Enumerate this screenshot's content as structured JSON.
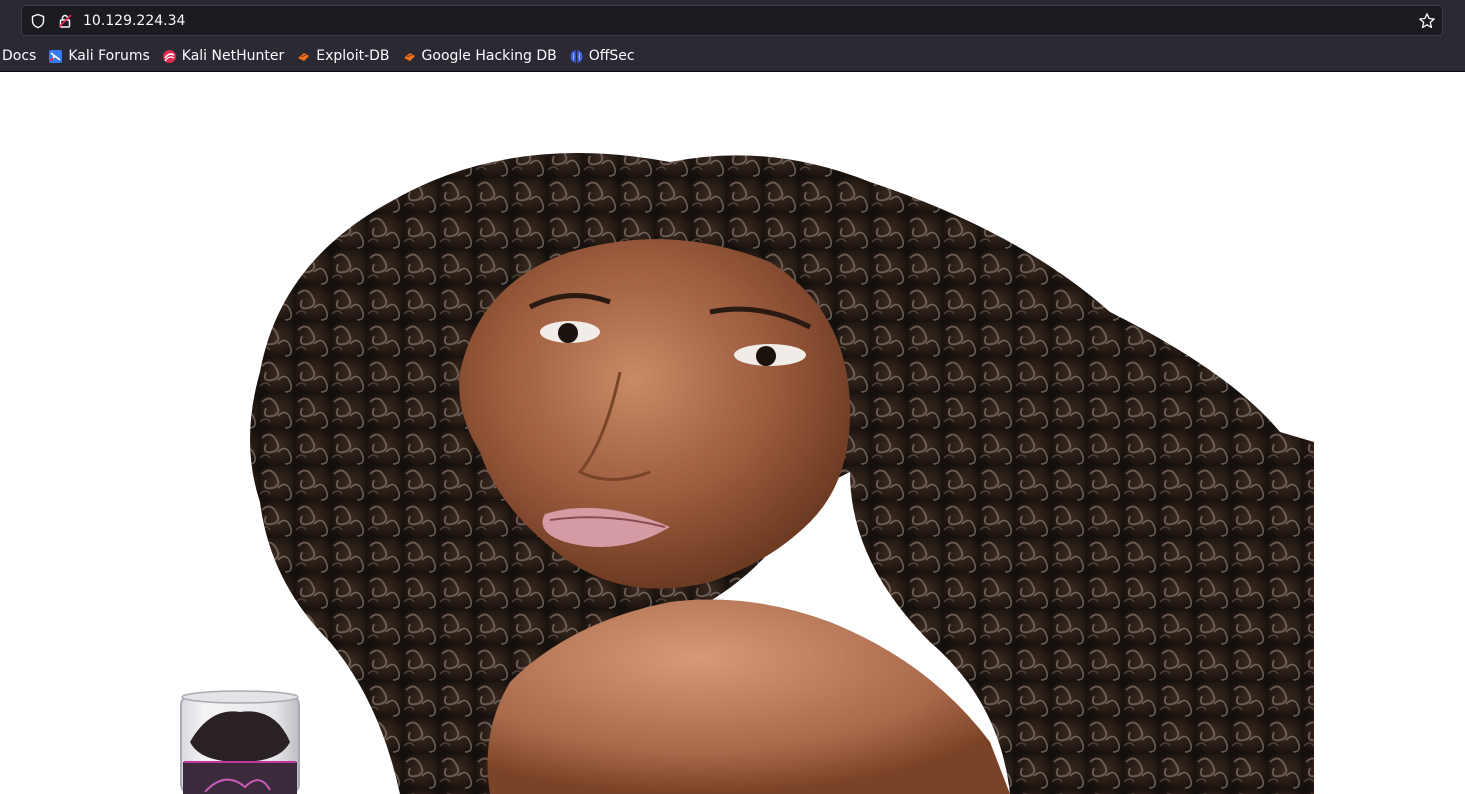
{
  "browser": {
    "url": "10.129.224.34",
    "icons": {
      "tracking_protection": "shield-icon",
      "connection": "lock-icon",
      "bookmark": "star-icon"
    }
  },
  "bookmarks": [
    {
      "label": "Docs",
      "icon": ""
    },
    {
      "label": "Kali Forums",
      "icon": "kali-forums-icon"
    },
    {
      "label": "Kali NetHunter",
      "icon": "kali-nethunter-icon"
    },
    {
      "label": "Exploit-DB",
      "icon": "exploit-db-icon"
    },
    {
      "label": "Google Hacking DB",
      "icon": "ghdb-icon"
    },
    {
      "label": "OffSec",
      "icon": "offsec-icon"
    }
  ],
  "page": {
    "background_color": "#ffffff",
    "hero_image": "woman-curly-hair-photo"
  },
  "colors": {
    "chrome_bg": "#2b2a33",
    "urlbar_bg": "#1c1b22",
    "text": "#fbfbfe"
  }
}
